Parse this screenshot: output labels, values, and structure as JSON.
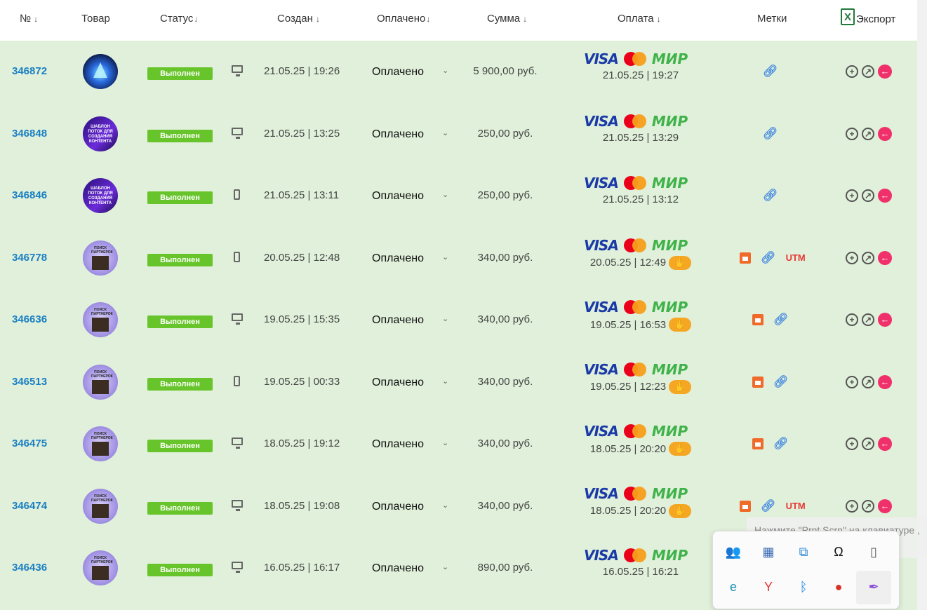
{
  "header": {
    "num": "№",
    "product": "Товар",
    "status": "Статус",
    "created": "Создан",
    "paid": "Оплачено",
    "sum": "Сумма",
    "payment": "Оплата",
    "tags": "Метки",
    "export": "Экспорт",
    "sort_arrow": "↓",
    "xls_letter": "X"
  },
  "rows": [
    {
      "id": "346872",
      "status": "Выполнен",
      "device": "desktop-icon",
      "created": "21.05.25 | 19:26",
      "paid": "Оплачено",
      "sum": "5 900,00 руб.",
      "pay_date": "21.05.25 | 19:27",
      "hand": false,
      "tags": [
        "link"
      ]
    },
    {
      "id": "346848",
      "status": "Выполнен",
      "device": "desktop-icon",
      "created": "21.05.25 | 13:25",
      "paid": "Оплачено",
      "sum": "250,00 руб.",
      "pay_date": "21.05.25 | 13:29",
      "hand": false,
      "tags": [
        "link"
      ]
    },
    {
      "id": "346846",
      "status": "Выполнен",
      "device": "mobile-icon",
      "created": "21.05.25 | 13:11",
      "paid": "Оплачено",
      "sum": "250,00 руб.",
      "pay_date": "21.05.25 | 13:12",
      "hand": false,
      "tags": [
        "link"
      ]
    },
    {
      "id": "346778",
      "status": "Выполнен",
      "device": "mobile-icon",
      "created": "20.05.25 | 12:48",
      "paid": "Оплачено",
      "sum": "340,00 руб.",
      "pay_date": "20.05.25 | 12:49",
      "hand": true,
      "tags": [
        "calendar",
        "link",
        "utm"
      ]
    },
    {
      "id": "346636",
      "status": "Выполнен",
      "device": "desktop-icon",
      "created": "19.05.25 | 15:35",
      "paid": "Оплачено",
      "sum": "340,00 руб.",
      "pay_date": "19.05.25 | 16:53",
      "hand": true,
      "tags": [
        "calendar",
        "link"
      ]
    },
    {
      "id": "346513",
      "status": "Выполнен",
      "device": "mobile-icon",
      "created": "19.05.25 | 00:33",
      "paid": "Оплачено",
      "sum": "340,00 руб.",
      "pay_date": "19.05.25 | 12:23",
      "hand": true,
      "tags": [
        "calendar",
        "link"
      ]
    },
    {
      "id": "346475",
      "status": "Выполнен",
      "device": "desktop-icon",
      "created": "18.05.25 | 19:12",
      "paid": "Оплачено",
      "sum": "340,00 руб.",
      "pay_date": "18.05.25 | 20:20",
      "hand": true,
      "tags": [
        "calendar",
        "link"
      ]
    },
    {
      "id": "346474",
      "status": "Выполнен",
      "device": "desktop-icon",
      "created": "18.05.25 | 19:08",
      "paid": "Оплачено",
      "sum": "340,00 руб.",
      "pay_date": "18.05.25 | 20:20",
      "hand": true,
      "tags": [
        "calendar",
        "link",
        "utm"
      ]
    },
    {
      "id": "346436",
      "status": "Выполнен",
      "device": "desktop-icon",
      "created": "16.05.25 | 16:17",
      "paid": "Оплачено",
      "sum": "890,00 руб.",
      "pay_date": "16.05.25 | 16:21",
      "hand": false,
      "tags": []
    }
  ],
  "card_brands": {
    "visa": "VISA",
    "mir": "МИР"
  },
  "utm_label": "UTM",
  "avatar_texts": {
    "template": "ШАБЛОН ПОТОК ДЛЯ СОЗДАНИЯ КОНТЕНТА",
    "search": "ПОИСК ПАРТНЕРОК"
  },
  "tray": {
    "tooltip": "Нажмите \"Prnt Scrn\" на клавиатуре ,\nсделать скриншот",
    "icons": [
      "teams-icon",
      "screen-capture-icon",
      "screen-share-icon",
      "notion-icon",
      "usb-drive-icon",
      "eset-icon",
      "yandex-icon",
      "bluetooth-icon",
      "chrome-notification-icon",
      "feather-icon"
    ]
  },
  "colors": {
    "row_bg": "#e0f0da",
    "id_link": "#1a7fc3",
    "status_badge": "#67c42a",
    "hand_badge": "#f5a623",
    "back_button": "#f0306a",
    "utm": "#e53935"
  }
}
